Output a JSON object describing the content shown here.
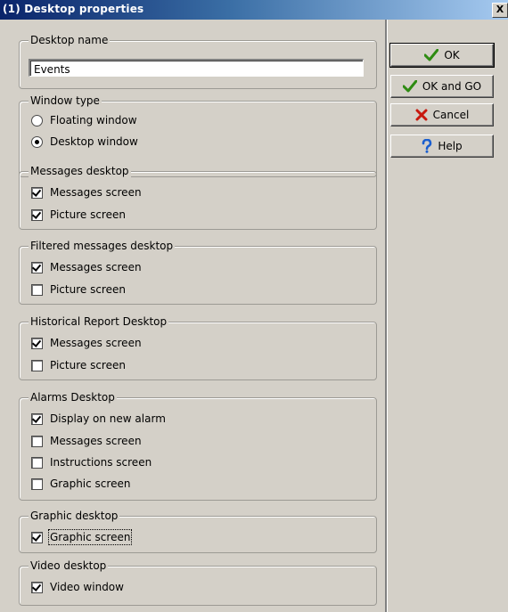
{
  "window": {
    "title": "(1) Desktop properties",
    "close_glyph": "X"
  },
  "desktop_name": {
    "legend": "Desktop name",
    "value": "Events"
  },
  "window_type": {
    "legend": "Window type",
    "options": [
      {
        "label": "Floating window",
        "selected": false
      },
      {
        "label": "Desktop window",
        "selected": true
      }
    ]
  },
  "groups": [
    {
      "legend": "Messages desktop",
      "items": [
        {
          "label": "Messages screen",
          "checked": true
        },
        {
          "label": "Picture screen",
          "checked": true
        }
      ]
    },
    {
      "legend": "Filtered messages desktop",
      "items": [
        {
          "label": "Messages screen",
          "checked": true
        },
        {
          "label": "Picture screen",
          "checked": false
        }
      ]
    },
    {
      "legend": "Historical Report Desktop",
      "items": [
        {
          "label": "Messages screen",
          "checked": true
        },
        {
          "label": "Picture screen",
          "checked": false
        }
      ]
    },
    {
      "legend": "Alarms Desktop",
      "items": [
        {
          "label": "Display on new alarm",
          "checked": true
        },
        {
          "label": "Messages screen",
          "checked": false
        },
        {
          "label": "Instructions screen",
          "checked": false
        },
        {
          "label": "Graphic screen",
          "checked": false
        }
      ]
    },
    {
      "legend": "Graphic desktop",
      "items": [
        {
          "label": "Graphic screen",
          "checked": true,
          "focused": true
        }
      ]
    },
    {
      "legend": "Video desktop",
      "items": [
        {
          "label": "Video window",
          "checked": true
        }
      ]
    }
  ],
  "buttons": {
    "ok": {
      "label": "OK",
      "icon": "check-icon"
    },
    "ok_go": {
      "label": "OK and GO",
      "icon": "check-icon"
    },
    "cancel": {
      "label": "Cancel",
      "icon": "x-icon"
    },
    "help": {
      "label": "Help",
      "icon": "question-icon"
    }
  },
  "colors": {
    "check_green": "#2e8b12",
    "cancel_red": "#c8180e",
    "help_blue": "#1a5fd0"
  }
}
